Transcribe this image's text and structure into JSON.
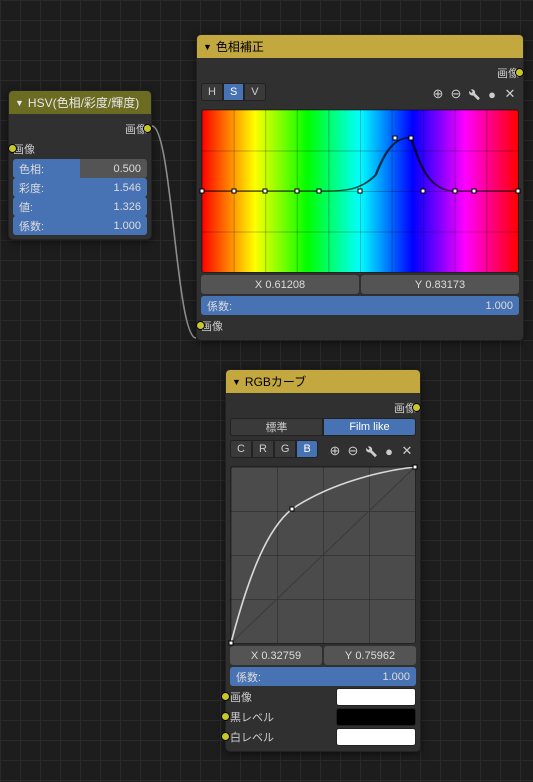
{
  "hsv_node": {
    "title": "HSV(色相/彩度/輝度)",
    "output_label": "画像",
    "input_label": "画像",
    "hue_label": "色相:",
    "hue_value": "0.500",
    "sat_label": "彩度:",
    "sat_value": "1.546",
    "val_label": "値:",
    "val_value": "1.326",
    "fac_label": "係数:",
    "fac_value": "1.000"
  },
  "hue_correct": {
    "title": "色相補正",
    "output_label": "画像",
    "tabs": {
      "h": "H",
      "s": "S",
      "v": "V",
      "active": "S"
    },
    "tools": {
      "zoom_in": "+",
      "zoom_out": "−",
      "wrench": "⚙",
      "clip": "●",
      "close": "✕"
    },
    "x_label": "X",
    "x_value": "0.61208",
    "y_label": "Y",
    "y_value": "0.83173",
    "fac_label": "係数:",
    "fac_value": "1.000",
    "input_label": "画像",
    "chart_data": {
      "type": "line",
      "xlim": [
        0,
        1
      ],
      "ylim": [
        0,
        1
      ],
      "points": [
        {
          "x": 0.0,
          "y": 0.5
        },
        {
          "x": 0.1,
          "y": 0.5
        },
        {
          "x": 0.2,
          "y": 0.5
        },
        {
          "x": 0.3,
          "y": 0.5
        },
        {
          "x": 0.37,
          "y": 0.5
        },
        {
          "x": 0.5,
          "y": 0.5
        },
        {
          "x": 0.61,
          "y": 0.83
        },
        {
          "x": 0.66,
          "y": 0.83
        },
        {
          "x": 0.7,
          "y": 0.5
        },
        {
          "x": 0.8,
          "y": 0.5
        },
        {
          "x": 0.86,
          "y": 0.5
        },
        {
          "x": 1.0,
          "y": 0.5
        }
      ]
    }
  },
  "rgb_curves": {
    "title": "RGBカーブ",
    "output_label": "画像",
    "mode": {
      "standard": "標準",
      "filmlike": "Film like",
      "active": "filmlike"
    },
    "channels": {
      "c": "C",
      "r": "R",
      "g": "G",
      "b": "B",
      "active": "B"
    },
    "tools": {
      "zoom_in": "+",
      "zoom_out": "−",
      "wrench": "⚙",
      "clip": "●",
      "close": "✕"
    },
    "x_label": "X",
    "x_value": "0.32759",
    "y_label": "Y",
    "y_value": "0.75962",
    "fac_label": "係数:",
    "fac_value": "1.000",
    "image_label": "画像",
    "black_label": "黒レベル",
    "white_label": "白レベル",
    "chart_data": {
      "type": "line",
      "xlim": [
        0,
        1
      ],
      "ylim": [
        0,
        1
      ],
      "points": [
        {
          "x": 0.0,
          "y": 0.0
        },
        {
          "x": 0.33,
          "y": 0.76
        },
        {
          "x": 1.0,
          "y": 1.0
        }
      ]
    }
  }
}
